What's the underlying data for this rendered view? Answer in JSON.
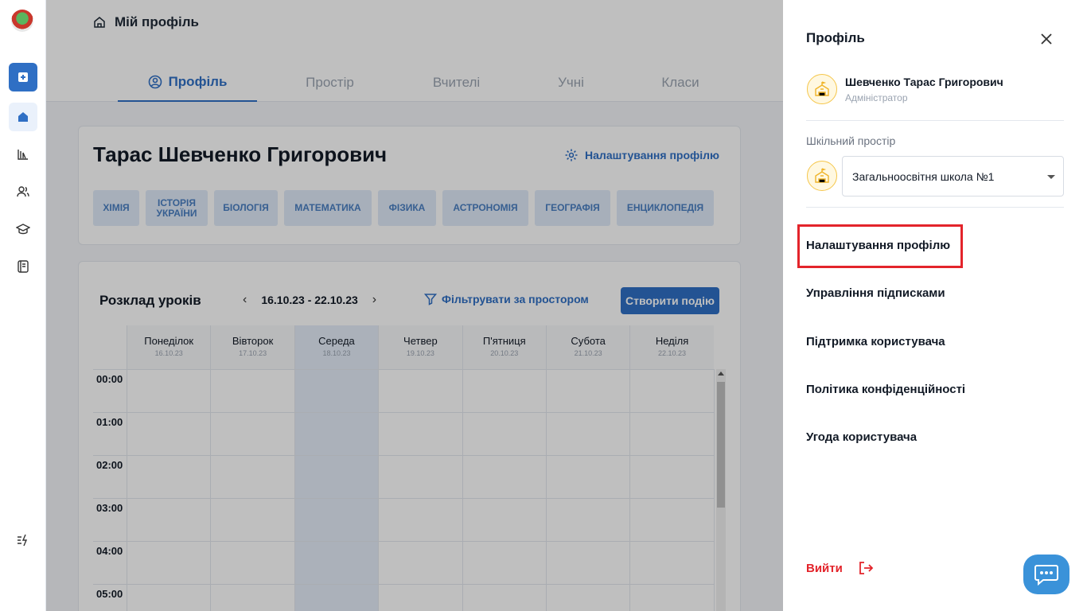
{
  "breadcrumb": {
    "title": "Мій профіль"
  },
  "tabs": [
    {
      "label": "Профіль"
    },
    {
      "label": "Простір"
    },
    {
      "label": "Вчителі"
    },
    {
      "label": "Учні"
    },
    {
      "label": "Класи"
    }
  ],
  "profile": {
    "name": "Тарас Шевченко Григорович",
    "settings_label": "Налаштування профілю",
    "subjects": [
      "ХІМІЯ",
      "ІСТОРІЯ УКРАЇНИ",
      "БІОЛОГІЯ",
      "МАТЕМАТИКА",
      "ФІЗИКА",
      "АСТРОНОМІЯ",
      "ГЕОГРАФІЯ",
      "ЕНЦИКЛОПЕДІЯ"
    ]
  },
  "schedule": {
    "title": "Розклад уроків",
    "range": "16.10.23 - 22.10.23",
    "prev": "‹",
    "next": "›",
    "filter_label": "Фільтрувати за простором",
    "create_label": "Створити подію",
    "days": [
      {
        "name": "Понеділок",
        "date": "16.10.23"
      },
      {
        "name": "Вівторок",
        "date": "17.10.23"
      },
      {
        "name": "Середа",
        "date": "18.10.23"
      },
      {
        "name": "Четвер",
        "date": "19.10.23"
      },
      {
        "name": "П'ятниця",
        "date": "20.10.23"
      },
      {
        "name": "Субота",
        "date": "21.10.23"
      },
      {
        "name": "Неділя",
        "date": "22.10.23"
      }
    ],
    "today_index": 2,
    "times": [
      "00:00",
      "01:00",
      "02:00",
      "03:00",
      "04:00",
      "05:00"
    ]
  },
  "panel": {
    "title": "Профіль",
    "user_name": "Шевченко Тарас Григорович",
    "user_role": "Адміністратор",
    "space_label": "Шкільний простір",
    "space_value": "Загальноосвітня школа №1",
    "menu": [
      "Налаштування профілю",
      "Управління підписками",
      "Підтримка користувача",
      "Політика конфіденційності",
      "Угода користувача"
    ],
    "logout_label": "Вийти"
  },
  "colors": {
    "accent": "#2f6fc4",
    "danger": "#e3242b",
    "chat": "#3a92d9"
  }
}
